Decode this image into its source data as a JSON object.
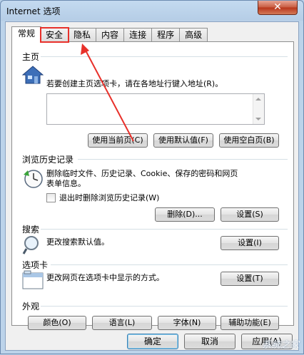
{
  "window": {
    "title": "Internet 选项",
    "close_label": "✕"
  },
  "tabs": [
    {
      "label": "常规"
    },
    {
      "label": "安全"
    },
    {
      "label": "隐私"
    },
    {
      "label": "内容"
    },
    {
      "label": "连接"
    },
    {
      "label": "程序"
    },
    {
      "label": "高级"
    }
  ],
  "home": {
    "group": "主页",
    "description": "若要创建主页选项卡，请在各地址行键入地址(R)。",
    "address_value": "",
    "btn_current": "使用当前页(C)",
    "btn_default": "使用默认值(F)",
    "btn_blank": "使用空白页(B)"
  },
  "history": {
    "group": "浏览历史记录",
    "description_line1": "删除临时文件、历史记录、Cookie、保存的密码和网页",
    "description_line2": "表单信息。",
    "checkbox_label": "退出时删除浏览历史记录(W)",
    "checkbox_checked": false,
    "btn_delete": "删除(D)...",
    "btn_settings": "设置(S)"
  },
  "search": {
    "group": "搜索",
    "description": "更改搜索默认值。",
    "btn_settings": "设置(I)"
  },
  "tabsgroup": {
    "group": "选项卡",
    "description": "更改网页在选项卡中显示的方式。",
    "btn_settings": "设置(T)"
  },
  "appearance": {
    "group": "外观",
    "btn_colors": "颜色(O)",
    "btn_languages": "语言(L)",
    "btn_fonts": "字体(N)",
    "btn_accessibility": "辅助功能(E)"
  },
  "footer": {
    "btn_ok": "确定",
    "btn_cancel": "取消",
    "btn_apply": "应用(A)"
  },
  "watermark": "系统之家",
  "colors": {
    "highlight": "#e8302a"
  }
}
